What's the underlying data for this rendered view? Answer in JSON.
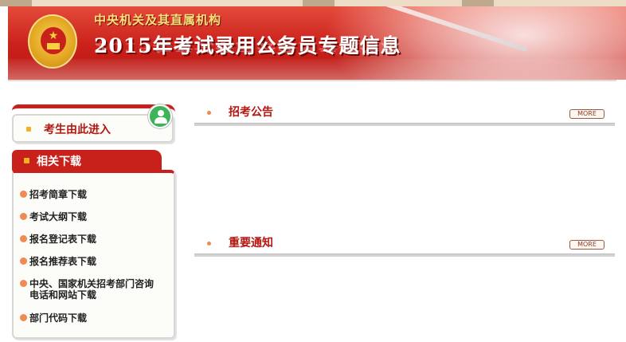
{
  "header": {
    "org_name": "中央机关及其直属机构",
    "title": "2015年考试录用公务员专题信息"
  },
  "sidebar": {
    "enter_label": "考生由此进入",
    "downloads_title": "相关下载",
    "downloads": [
      "招考简章下载",
      "考试大纲下载",
      "报名登记表下载",
      "报名推荐表下载",
      "中央、国家机关招考部门咨询电话和网站下载",
      "部门代码下载"
    ]
  },
  "sections": [
    {
      "title": "招考公告",
      "more_label": "MORE"
    },
    {
      "title": "重要通知",
      "more_label": "MORE"
    }
  ],
  "colors": {
    "brand_red": "#c8201a",
    "accent_orange": "#ee8a52",
    "title_red": "#b4170f"
  },
  "icons": [
    "national-emblem-icon",
    "user-icon",
    "bullet-icon"
  ]
}
